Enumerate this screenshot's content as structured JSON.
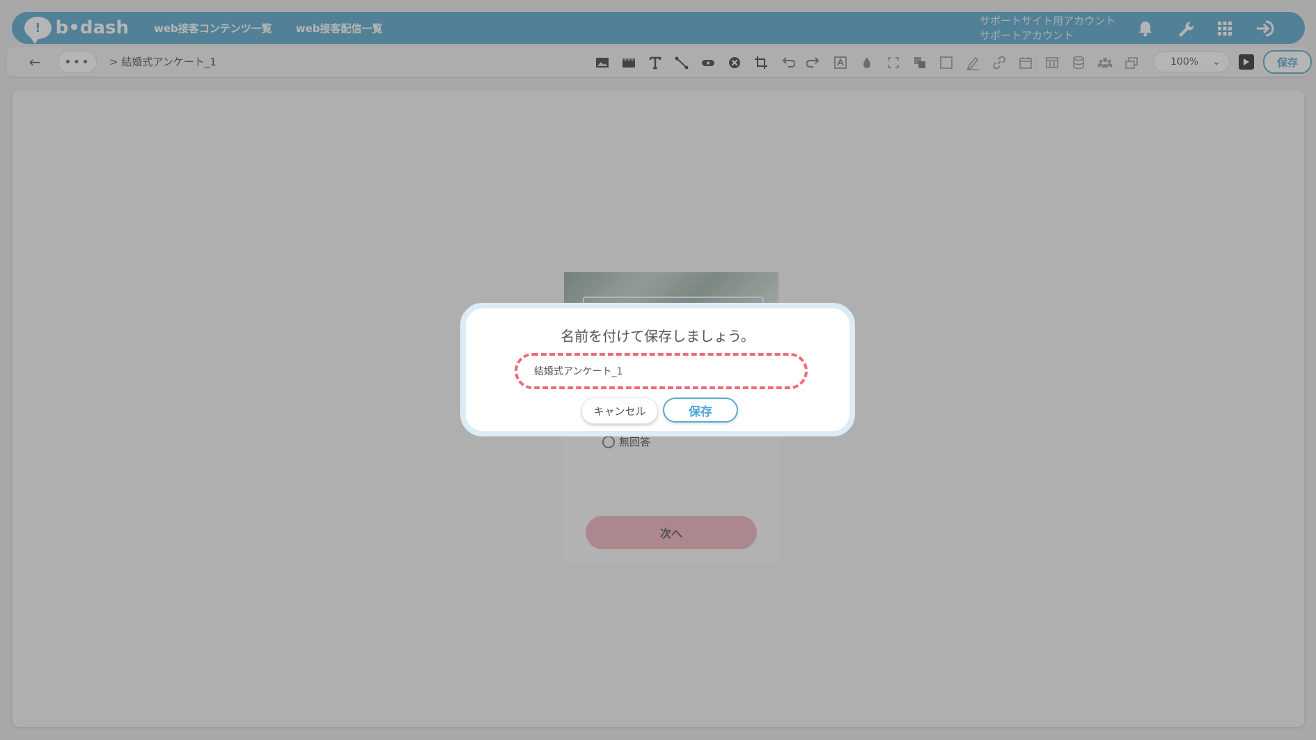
{
  "header": {
    "logo_text": "b•dash",
    "logo_glyph": "!",
    "nav": [
      "web接客コンテンツ一覧",
      "web接客配信一覧"
    ],
    "account_line1": "サポートサイト用アカウント",
    "account_line2": "サポートアカウント",
    "icons": [
      "bell-icon",
      "wrench-icon",
      "apps-grid-icon",
      "logout-icon"
    ]
  },
  "toolbar": {
    "back_glyph": "←",
    "more_glyph": "•••",
    "breadcrumb": "> 結婚式アンケート_1",
    "zoom": "100%",
    "zoom_caret": "⌄",
    "save_label": "保存",
    "tools": [
      "image-icon",
      "video-icon",
      "text-icon",
      "line-icon",
      "button-icon",
      "close-button-icon",
      "crop-icon",
      "undo-icon",
      "redo-icon",
      "text-frame-icon",
      "drop-icon",
      "fullscreen-icon",
      "layer-icon",
      "square-icon",
      "pen-icon",
      "link-icon",
      "calendar-icon",
      "table-icon",
      "database-icon",
      "users-icon",
      "copy-icon"
    ]
  },
  "preview": {
    "radio_label": "無回答",
    "next_label": "次へ"
  },
  "modal": {
    "title": "名前を付けて保存しましょう。",
    "input_value": "結婚式アンケート_1",
    "cancel_label": "キャンセル",
    "save_label": "保存"
  },
  "colors": {
    "header_bg": "#5aa9ce",
    "accent": "#4aa6d6",
    "highlight_dash": "#ef6b79",
    "next_button": "#f1b4bf"
  }
}
